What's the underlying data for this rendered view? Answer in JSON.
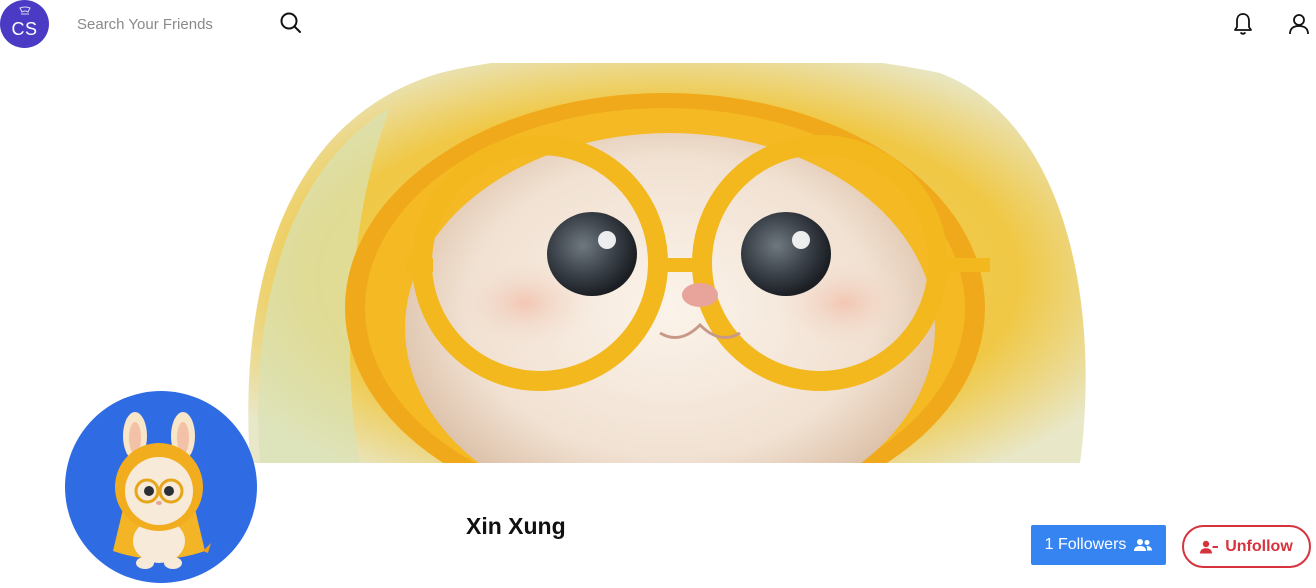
{
  "header": {
    "logo_text": "CS",
    "search": {
      "placeholder": "Search Your Friends",
      "value": ""
    },
    "icons": [
      "search-icon",
      "bell-icon",
      "user-icon"
    ]
  },
  "profile": {
    "name": "Xin Xung",
    "followers_label": "1 Followers",
    "unfollow_label": "Unfollow"
  },
  "colors": {
    "logo_bg": "#4b3bc4",
    "avatar_bg": "#2f6ce3",
    "followers_button": "#3584f2",
    "unfollow_accent": "#d6333d",
    "cover_hood": "#f2b01e"
  }
}
